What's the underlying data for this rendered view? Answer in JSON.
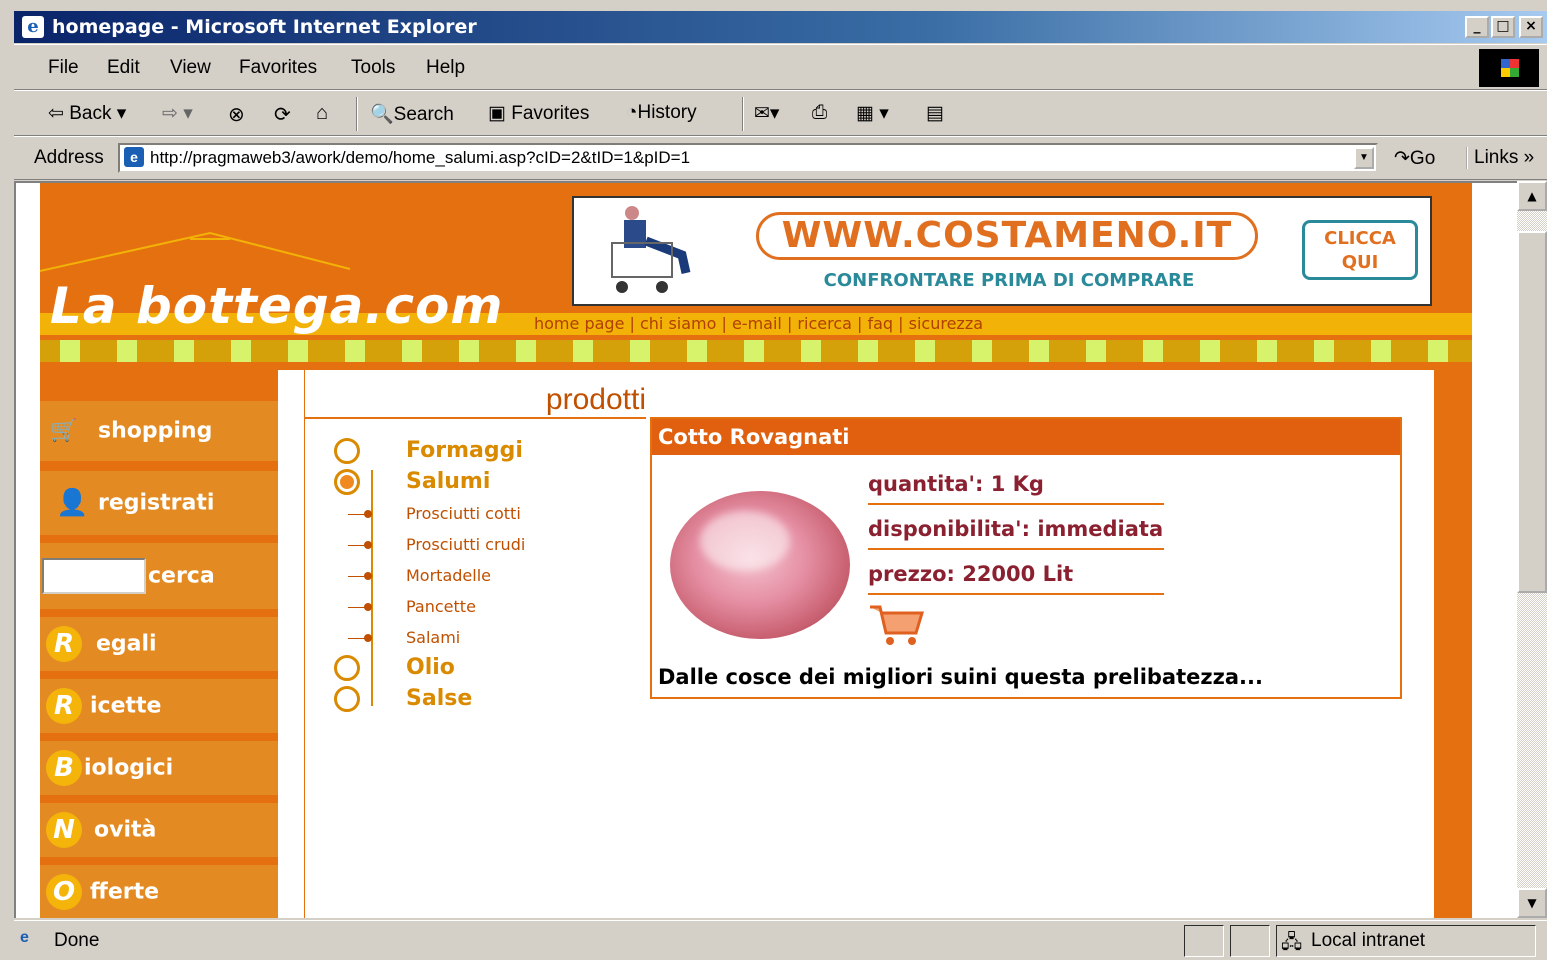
{
  "window": {
    "title": "homepage - Microsoft Internet Explorer",
    "min": "_",
    "max": "□",
    "close": "×"
  },
  "menu": [
    "File",
    "Edit",
    "View",
    "Favorites",
    "Tools",
    "Help"
  ],
  "toolbar": {
    "back": "⇦ Back ▾",
    "forward": "⇨ ▾",
    "search": "Search",
    "favorites": "Favorites",
    "history": "History"
  },
  "address": {
    "label": "Address",
    "url": "http://pragmaweb3/awork/demo/home_salumi.asp?cID=2&tID=1&pID=1",
    "go": "Go",
    "links": "Links »"
  },
  "site": {
    "logo": "La bottega.com",
    "toplinks": "home page | chi siamo | e-mail | ricerca | faq | sicurezza",
    "banner": {
      "url": "WWW.COSTAMENO.IT",
      "tagline": "CONFRONTARE PRIMA DI COMPRARE",
      "cta": "CLICCA QUI"
    },
    "section_title": "prodotti",
    "nav": {
      "shopping": "shopping",
      "registrati": "registrati",
      "cerca": "cerca",
      "items": [
        {
          "letter": "R",
          "rest": "egali"
        },
        {
          "letter": "R",
          "rest": "icette"
        },
        {
          "letter": "B",
          "rest": "iologici"
        },
        {
          "letter": "N",
          "rest": "ovità"
        },
        {
          "letter": "O",
          "rest": "fferte"
        }
      ]
    },
    "categories": {
      "formaggi": "Formaggi",
      "salumi": "Salumi",
      "sub": [
        "Prosciutti cotti",
        "Prosciutti crudi",
        "Mortadelle",
        "Pancette",
        "Salami"
      ],
      "olio": "Olio",
      "salse": "Salse"
    },
    "product": {
      "name": "Cotto Rovagnati",
      "quantita": "quantita': 1 Kg",
      "disponibilita": "disponibilita': immediata",
      "prezzo": "prezzo: 22000 Lit",
      "description": "Dalle cosce dei migliori suini questa prelibatezza..."
    }
  },
  "status": {
    "text": "Done",
    "zone": "Local intranet"
  }
}
